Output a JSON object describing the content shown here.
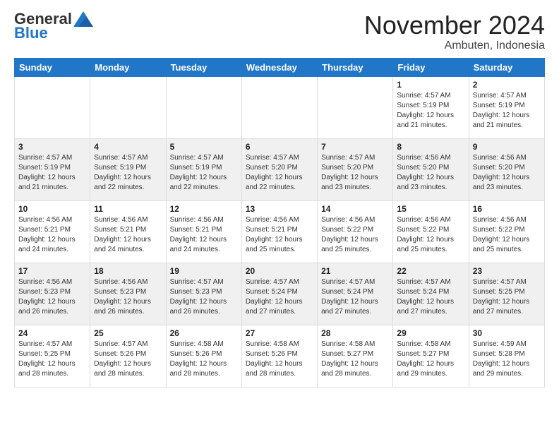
{
  "header": {
    "logo_general": "General",
    "logo_blue": "Blue",
    "month_title": "November 2024",
    "location": "Ambuten, Indonesia"
  },
  "calendar": {
    "days_of_week": [
      "Sunday",
      "Monday",
      "Tuesday",
      "Wednesday",
      "Thursday",
      "Friday",
      "Saturday"
    ],
    "weeks": [
      [
        {
          "day": "",
          "info": ""
        },
        {
          "day": "",
          "info": ""
        },
        {
          "day": "",
          "info": ""
        },
        {
          "day": "",
          "info": ""
        },
        {
          "day": "",
          "info": ""
        },
        {
          "day": "1",
          "info": "Sunrise: 4:57 AM\nSunset: 5:19 PM\nDaylight: 12 hours\nand 21 minutes."
        },
        {
          "day": "2",
          "info": "Sunrise: 4:57 AM\nSunset: 5:19 PM\nDaylight: 12 hours\nand 21 minutes."
        }
      ],
      [
        {
          "day": "3",
          "info": "Sunrise: 4:57 AM\nSunset: 5:19 PM\nDaylight: 12 hours\nand 21 minutes."
        },
        {
          "day": "4",
          "info": "Sunrise: 4:57 AM\nSunset: 5:19 PM\nDaylight: 12 hours\nand 22 minutes."
        },
        {
          "day": "5",
          "info": "Sunrise: 4:57 AM\nSunset: 5:19 PM\nDaylight: 12 hours\nand 22 minutes."
        },
        {
          "day": "6",
          "info": "Sunrise: 4:57 AM\nSunset: 5:20 PM\nDaylight: 12 hours\nand 22 minutes."
        },
        {
          "day": "7",
          "info": "Sunrise: 4:57 AM\nSunset: 5:20 PM\nDaylight: 12 hours\nand 23 minutes."
        },
        {
          "day": "8",
          "info": "Sunrise: 4:56 AM\nSunset: 5:20 PM\nDaylight: 12 hours\nand 23 minutes."
        },
        {
          "day": "9",
          "info": "Sunrise: 4:56 AM\nSunset: 5:20 PM\nDaylight: 12 hours\nand 23 minutes."
        }
      ],
      [
        {
          "day": "10",
          "info": "Sunrise: 4:56 AM\nSunset: 5:21 PM\nDaylight: 12 hours\nand 24 minutes."
        },
        {
          "day": "11",
          "info": "Sunrise: 4:56 AM\nSunset: 5:21 PM\nDaylight: 12 hours\nand 24 minutes."
        },
        {
          "day": "12",
          "info": "Sunrise: 4:56 AM\nSunset: 5:21 PM\nDaylight: 12 hours\nand 24 minutes."
        },
        {
          "day": "13",
          "info": "Sunrise: 4:56 AM\nSunset: 5:21 PM\nDaylight: 12 hours\nand 25 minutes."
        },
        {
          "day": "14",
          "info": "Sunrise: 4:56 AM\nSunset: 5:22 PM\nDaylight: 12 hours\nand 25 minutes."
        },
        {
          "day": "15",
          "info": "Sunrise: 4:56 AM\nSunset: 5:22 PM\nDaylight: 12 hours\nand 25 minutes."
        },
        {
          "day": "16",
          "info": "Sunrise: 4:56 AM\nSunset: 5:22 PM\nDaylight: 12 hours\nand 25 minutes."
        }
      ],
      [
        {
          "day": "17",
          "info": "Sunrise: 4:56 AM\nSunset: 5:23 PM\nDaylight: 12 hours\nand 26 minutes."
        },
        {
          "day": "18",
          "info": "Sunrise: 4:56 AM\nSunset: 5:23 PM\nDaylight: 12 hours\nand 26 minutes."
        },
        {
          "day": "19",
          "info": "Sunrise: 4:57 AM\nSunset: 5:23 PM\nDaylight: 12 hours\nand 26 minutes."
        },
        {
          "day": "20",
          "info": "Sunrise: 4:57 AM\nSunset: 5:24 PM\nDaylight: 12 hours\nand 27 minutes."
        },
        {
          "day": "21",
          "info": "Sunrise: 4:57 AM\nSunset: 5:24 PM\nDaylight: 12 hours\nand 27 minutes."
        },
        {
          "day": "22",
          "info": "Sunrise: 4:57 AM\nSunset: 5:24 PM\nDaylight: 12 hours\nand 27 minutes."
        },
        {
          "day": "23",
          "info": "Sunrise: 4:57 AM\nSunset: 5:25 PM\nDaylight: 12 hours\nand 27 minutes."
        }
      ],
      [
        {
          "day": "24",
          "info": "Sunrise: 4:57 AM\nSunset: 5:25 PM\nDaylight: 12 hours\nand 28 minutes."
        },
        {
          "day": "25",
          "info": "Sunrise: 4:57 AM\nSunset: 5:26 PM\nDaylight: 12 hours\nand 28 minutes."
        },
        {
          "day": "26",
          "info": "Sunrise: 4:58 AM\nSunset: 5:26 PM\nDaylight: 12 hours\nand 28 minutes."
        },
        {
          "day": "27",
          "info": "Sunrise: 4:58 AM\nSunset: 5:26 PM\nDaylight: 12 hours\nand 28 minutes."
        },
        {
          "day": "28",
          "info": "Sunrise: 4:58 AM\nSunset: 5:27 PM\nDaylight: 12 hours\nand 28 minutes."
        },
        {
          "day": "29",
          "info": "Sunrise: 4:58 AM\nSunset: 5:27 PM\nDaylight: 12 hours\nand 29 minutes."
        },
        {
          "day": "30",
          "info": "Sunrise: 4:59 AM\nSunset: 5:28 PM\nDaylight: 12 hours\nand 29 minutes."
        }
      ]
    ]
  }
}
